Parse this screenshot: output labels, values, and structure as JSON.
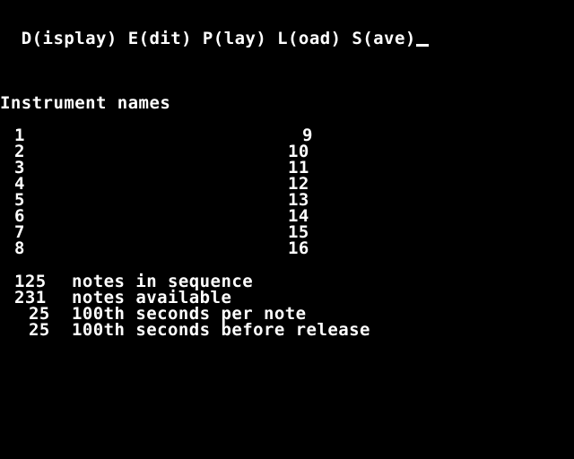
{
  "menu": {
    "display": "D(isplay)",
    "edit": "E(dit)",
    "play": "P(lay)",
    "load": "L(oad)",
    "save": "S(ave)"
  },
  "instruments": {
    "heading": "Instrument names",
    "left_column": [
      "1",
      "2",
      "3",
      "4",
      "5",
      "6",
      "7",
      "8"
    ],
    "right_column": [
      "9",
      "10",
      "11",
      "12",
      "13",
      "14",
      "15",
      "16"
    ]
  },
  "stats": [
    {
      "value": "125",
      "label": "notes in sequence"
    },
    {
      "value": "231",
      "label": "notes available"
    },
    {
      "value": "25",
      "label": "100th seconds per note"
    },
    {
      "value": "25",
      "label": "100th seconds before release"
    }
  ],
  "colors": {
    "background": "#000000",
    "text": "#ffffff"
  }
}
